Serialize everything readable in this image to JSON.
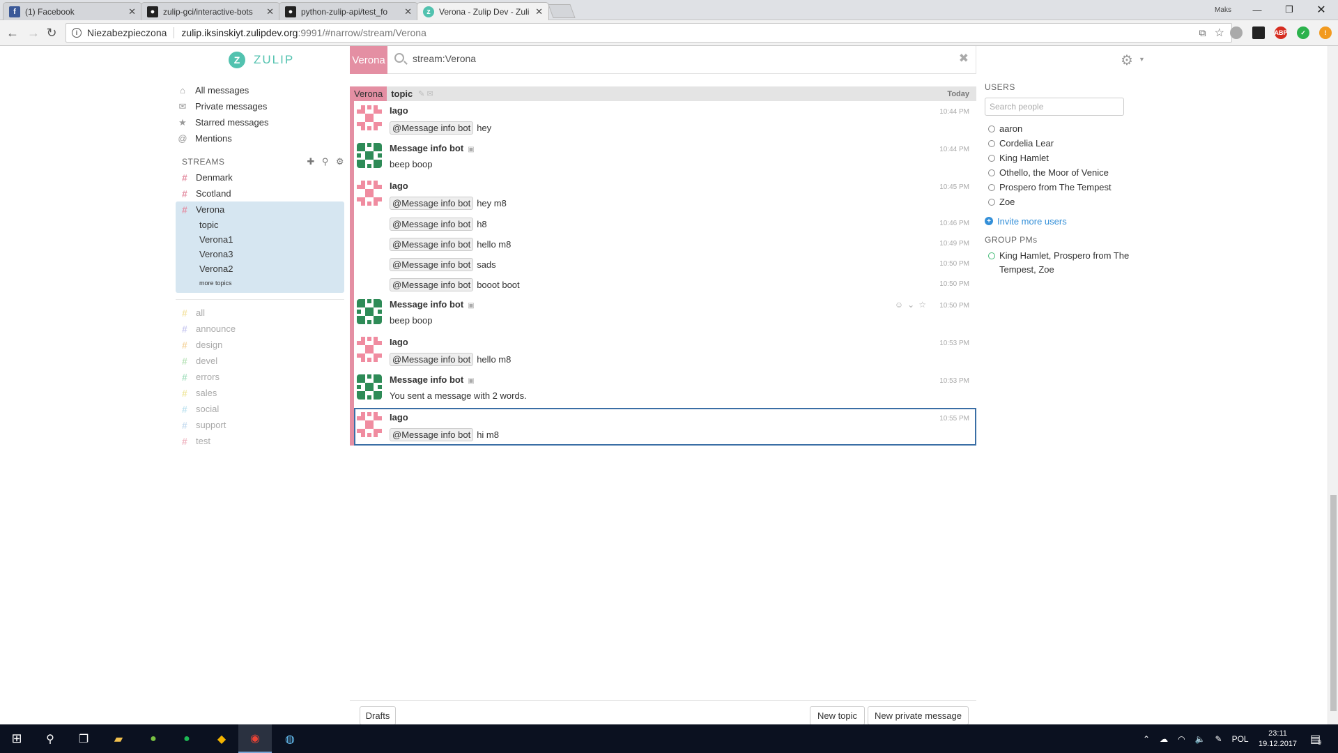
{
  "browser": {
    "tabs": [
      {
        "title": "(1) Facebook",
        "icon": "facebook-icon",
        "icon_color": "#3b5998"
      },
      {
        "title": "zulip-gci/interactive-bots",
        "icon": "github-icon",
        "icon_color": "#222222"
      },
      {
        "title": "python-zulip-api/test_fo",
        "icon": "github-icon",
        "icon_color": "#222222"
      },
      {
        "title": "Verona - Zulip Dev - Zuli",
        "icon": "zulip-icon",
        "icon_color": "#52c2af"
      }
    ],
    "user_label": "Maks",
    "security_label": "Niezabezpieczona",
    "url_host": "zulip.iksinskiyt.zulipdev.org",
    "url_path": ":9991/#narrow/stream/Verona"
  },
  "zulip": {
    "brand": "ZULIP",
    "search": {
      "stream_pill": "Verona",
      "query": "stream:Verona"
    },
    "global_filters": [
      {
        "label": "All messages",
        "icon": "home-icon",
        "glyph": "⌂"
      },
      {
        "label": "Private messages",
        "icon": "envelope-icon",
        "glyph": "✉"
      },
      {
        "label": "Starred messages",
        "icon": "star-icon",
        "glyph": "★"
      },
      {
        "label": "Mentions",
        "icon": "at-icon",
        "glyph": "@"
      }
    ],
    "streams_header": "STREAMS",
    "subscribed_streams": [
      {
        "name": "Denmark",
        "color": "#e48fa3"
      },
      {
        "name": "Scotland",
        "color": "#e48fa3"
      }
    ],
    "active_stream": {
      "name": "Verona",
      "color": "#e48fa3",
      "topics": [
        "topic",
        "Verona1",
        "Verona3",
        "Verona2"
      ],
      "more_topics": "more topics"
    },
    "other_streams": [
      {
        "name": "all",
        "color": "#f4e3a3"
      },
      {
        "name": "announce",
        "color": "#c8c8f0"
      },
      {
        "name": "design",
        "color": "#f4d5a0"
      },
      {
        "name": "devel",
        "color": "#b9e3b9"
      },
      {
        "name": "errors",
        "color": "#a7e0c0"
      },
      {
        "name": "sales",
        "color": "#f0e7a0"
      },
      {
        "name": "social",
        "color": "#bfe3f0"
      },
      {
        "name": "support",
        "color": "#c8ddf0"
      },
      {
        "name": "test",
        "color": "#f0b8c4"
      }
    ],
    "recipient_bar": {
      "stream": "Verona",
      "topic": "topic",
      "date": "Today"
    },
    "messages": [
      {
        "sender": "Iago",
        "avatar": "iago",
        "time": "10:44 PM",
        "mention": "@Message info bot",
        "text": "hey"
      },
      {
        "sender": "Message info bot",
        "avatar": "bot",
        "bot": true,
        "time": "10:44 PM",
        "mention": "",
        "text": "beep boop"
      },
      {
        "sender": "Iago",
        "avatar": "iago",
        "time": "10:45 PM",
        "mention": "@Message info bot",
        "text": "hey m8"
      },
      {
        "sender": "",
        "time": "10:46 PM",
        "mention": "@Message info bot",
        "text": "h8"
      },
      {
        "sender": "",
        "time": "10:49 PM",
        "mention": "@Message info bot",
        "text": "hello m8"
      },
      {
        "sender": "",
        "time": "10:50 PM",
        "mention": "@Message info bot",
        "text": "sads"
      },
      {
        "sender": "",
        "time": "10:50 PM",
        "mention": "@Message info bot",
        "text": "booot boot"
      },
      {
        "sender": "Message info bot",
        "avatar": "bot",
        "bot": true,
        "time": "10:50 PM",
        "mention": "",
        "text": "beep boop",
        "hover": true
      },
      {
        "sender": "Iago",
        "avatar": "iago",
        "time": "10:53 PM",
        "mention": "@Message info bot",
        "text": "hello m8"
      },
      {
        "sender": "Message info bot",
        "avatar": "bot",
        "bot": true,
        "time": "10:53 PM",
        "mention": "",
        "text": "You sent a message with 2 words."
      },
      {
        "sender": "Iago",
        "avatar": "iago",
        "time": "10:55 PM",
        "mention": "@Message info bot",
        "text": "hi m8",
        "selected": true
      }
    ],
    "compose": {
      "drafts": "Drafts",
      "new_topic": "New topic",
      "new_pm": "New private message"
    },
    "users_header": "USERS",
    "user_search_placeholder": "Search people",
    "users": [
      "aaron",
      "Cordelia Lear",
      "King Hamlet",
      "Othello, the Moor of Venice",
      "Prospero from The Tempest",
      "Zoe"
    ],
    "invite_label": "Invite more users",
    "group_pms_header": "GROUP PMs",
    "group_pms": [
      "King Hamlet, Prospero from The Tempest, Zoe"
    ]
  },
  "taskbar": {
    "language": "POL",
    "time": "23:11",
    "date": "19.12.2017",
    "notifications": "9"
  }
}
